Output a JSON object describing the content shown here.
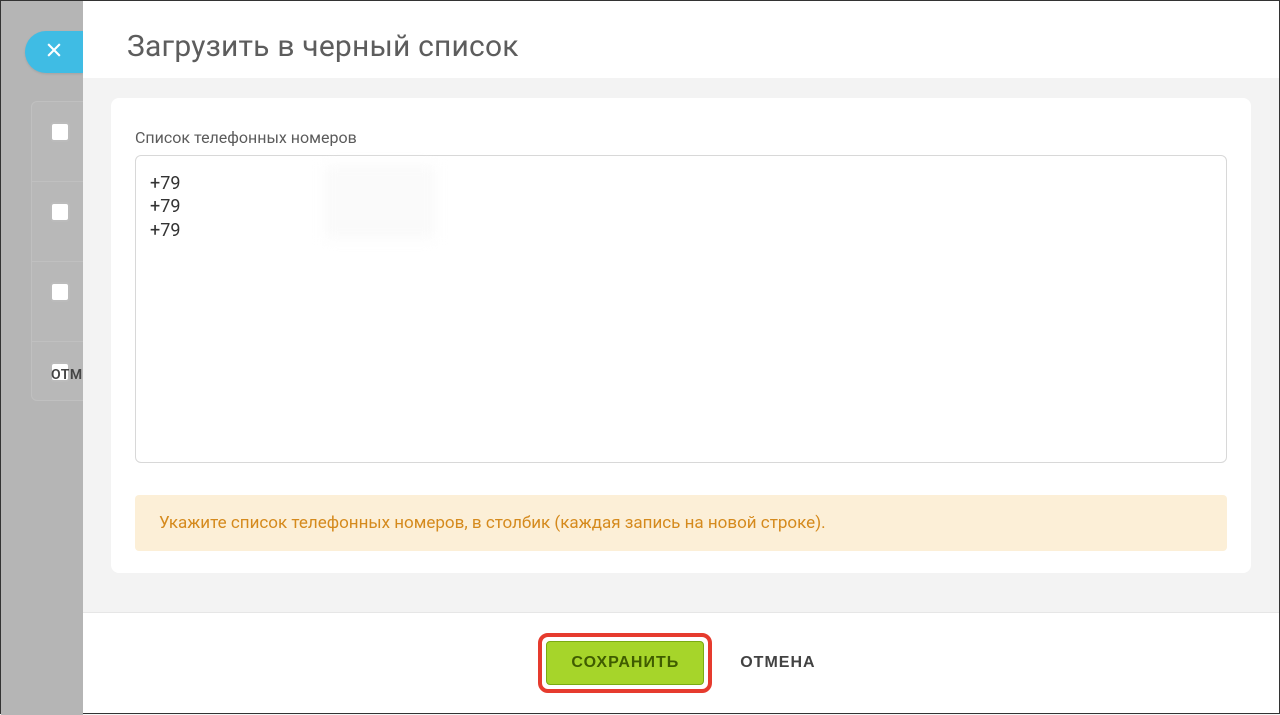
{
  "background": {
    "cancel_label": "ОТМ"
  },
  "modal": {
    "title": "Загрузить в черный список",
    "field_label": "Список телефонных номеров",
    "textarea_value": "+79\n+79\n+79",
    "hint": "Укажите список телефонных номеров, в столбик (каждая запись на новой строке).",
    "save_label": "СОХРАНИТЬ",
    "cancel_label": "ОТМЕНА"
  }
}
